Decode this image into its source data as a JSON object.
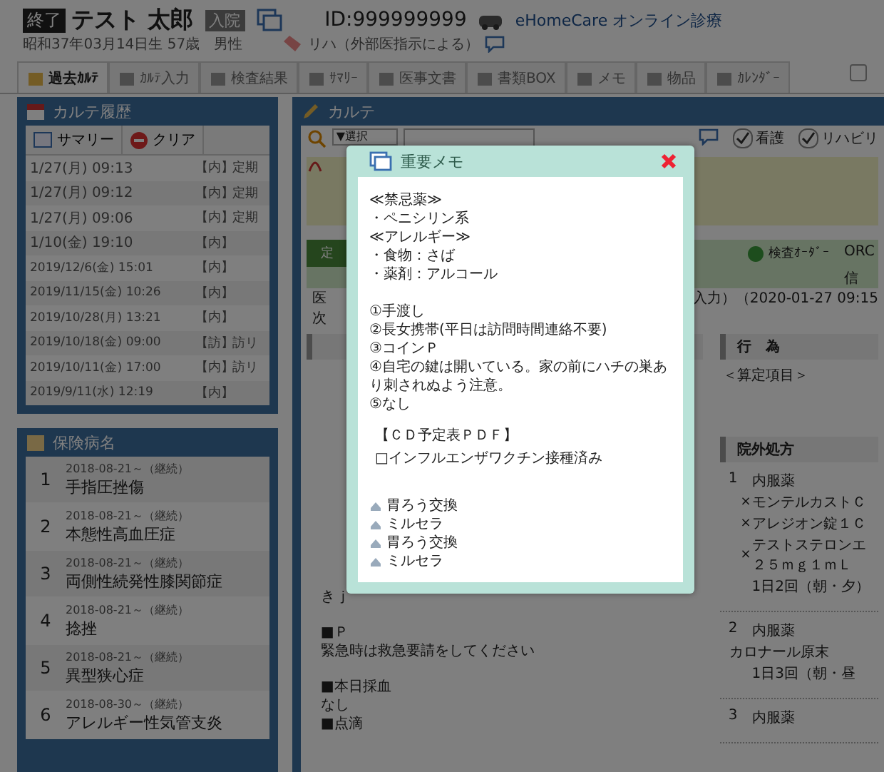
{
  "header": {
    "status": "終了",
    "name": "テスト 太郎",
    "ward_badge": "入院",
    "patient_id": "ID:999999999",
    "online_link": "eHomeCare オンライン診療",
    "birth_info": "昭和37年03月14日生 57歳　男性",
    "rehab_tag": "リハ（外部医指示による）",
    "top_checkbox": {
      "checked": false
    }
  },
  "tabs": [
    {
      "label": "過去ｶﾙﾃ",
      "selected": true
    },
    {
      "label": "ｶﾙﾃ入力",
      "selected": false
    },
    {
      "label": "検査結果",
      "selected": false
    },
    {
      "label": "ｻﾏﾘｰ",
      "selected": false
    },
    {
      "label": "医事文書",
      "selected": false
    },
    {
      "label": "書類BOX",
      "selected": false
    },
    {
      "label": "メモ",
      "selected": false
    },
    {
      "label": "物品",
      "selected": false
    },
    {
      "label": "ｶﾚﾝﾀﾞｰ",
      "selected": false
    }
  ],
  "history": {
    "title": "カルテ履歴",
    "summary_button": "サマリー",
    "clear_button": "クリア",
    "rows": [
      {
        "date": "1/27(月) 09:13",
        "type": "【内】",
        "tag": "定期",
        "kind": "recent"
      },
      {
        "date": "1/27(月) 09:12",
        "type": "【内】",
        "tag": "定期",
        "kind": "recent"
      },
      {
        "date": "1/27(月) 09:06",
        "type": "【内】",
        "tag": "定期",
        "kind": "recent"
      },
      {
        "date": "1/10(金) 19:10",
        "type": "【内】",
        "kind": "recent"
      },
      {
        "date": "2019/12/6(金) 15:01",
        "type": "【内】",
        "kind": "past"
      },
      {
        "date": "2019/11/15(金) 10:26",
        "type": "【内】",
        "kind": "past"
      },
      {
        "date": "2019/10/28(月) 13:21",
        "type": "【内】",
        "kind": "past"
      },
      {
        "date": "2019/10/18(金) 09:00",
        "type": "【訪】",
        "tag": "訪リ",
        "kind": "past"
      },
      {
        "date": "2019/10/11(金) 17:00",
        "type": "【内】",
        "tag": "訪リ",
        "kind": "past"
      },
      {
        "date": "2019/9/11(水) 12:19",
        "type": "【内】",
        "kind": "past"
      }
    ]
  },
  "diseases": {
    "title": "保険病名",
    "rows": [
      {
        "no": "1",
        "since": "2018-08-21～（継続）",
        "name": "手指圧挫傷"
      },
      {
        "no": "2",
        "since": "2018-08-21～（継続）",
        "name": "本態性高血圧症"
      },
      {
        "no": "3",
        "since": "2018-08-21～（継続）",
        "name": "両側性続発性膝関節症"
      },
      {
        "no": "4",
        "since": "2018-08-21～（継続）",
        "name": "捻挫"
      },
      {
        "no": "5",
        "since": "2018-08-21～（継続）",
        "name": "異型狭心症"
      },
      {
        "no": "6",
        "since": "2018-08-30～（継続）",
        "name": "アレルギー性気管支炎"
      }
    ]
  },
  "karte": {
    "title": "カルテ",
    "filter_select": "▼選択",
    "checks": [
      {
        "label": "看護",
        "checked": true
      },
      {
        "label": "リハビリ",
        "checked": true
      }
    ],
    "order_bar": {
      "left_text": "定",
      "order_button": "検査ｵｰﾀﾞｰ",
      "orca_button": "ORC",
      "orca_sub": "信"
    },
    "doctor_left": "医",
    "doctor_right": "入力）（2020-01-27 09:15",
    "next_left": "次",
    "soap_blocks": [
      [
        "きｊ"
      ],
      [
        "■Ｐ",
        "緊急時は救急要請をしてください"
      ],
      [
        "■本日採血",
        "なし",
        "■点滴"
      ]
    ],
    "acts": {
      "title": "行　為",
      "items": [
        "＜算定項目＞"
      ]
    },
    "prescription": {
      "title": "院外処方",
      "entries": [
        {
          "no": "1",
          "type": "内服薬",
          "drugs": [
            {
              "mark": "×",
              "lines": [
                "モンテルカストＣ"
              ]
            },
            {
              "mark": "×",
              "lines": [
                "アレジオン錠１Ｃ"
              ]
            },
            {
              "mark": "×",
              "lines": [
                "テストステロンエ",
                "２５ｍｇ１ｍＬ"
              ]
            }
          ],
          "usage": "1日2回（朝・夕）"
        },
        {
          "no": "2",
          "type": "内服薬",
          "drugs": [
            {
              "lines": [
                "カロナール原末"
              ]
            }
          ],
          "usage": "1日3回（朝・昼"
        },
        {
          "no": "3",
          "type": "内服薬"
        }
      ]
    }
  },
  "memo_dialog": {
    "title": "重要メモ",
    "paragraphs": [
      [
        "≪禁忌薬≫",
        "・ペニシリン系",
        "≪アレルギー≫",
        "・食物：さば",
        "・薬剤：アルコール"
      ],
      [
        "①手渡し",
        "②長女携帯(平日は訪問時間連絡不要)",
        "③コインＰ",
        "④自宅の鍵は開いている。家の前にハチの巣あり刺されぬよう注意。",
        "⑤なし"
      ]
    ],
    "attachments": [
      "【ＣＤ予定表ＰＤＦ】",
      "□インフルエンザワクチン接種済み"
    ],
    "items": [
      "胃ろう交換",
      "ミルセラ",
      "胃ろう交換",
      "ミルセラ"
    ]
  }
}
